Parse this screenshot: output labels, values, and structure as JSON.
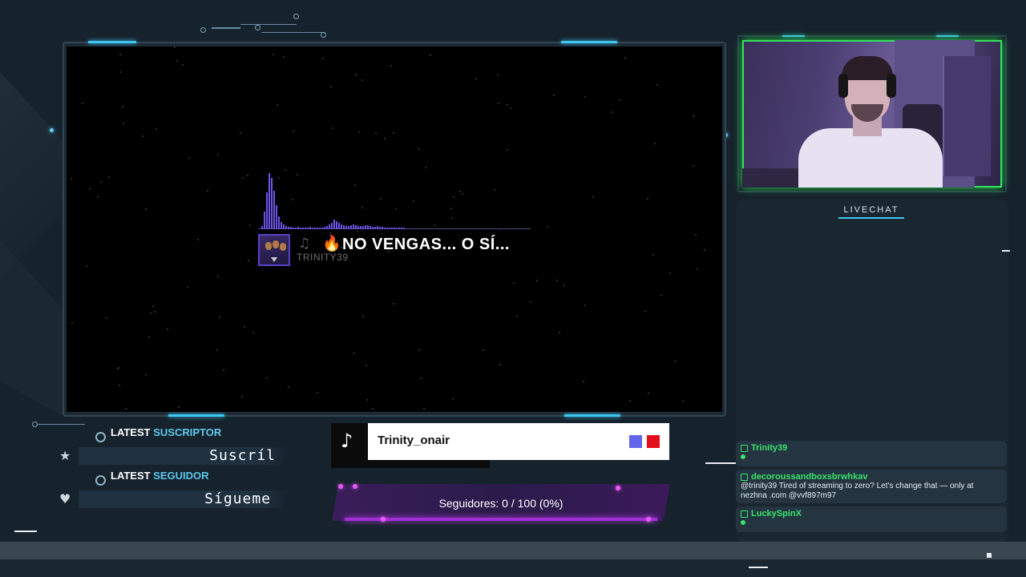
{
  "music_player": {
    "song_title": "NO VENGAS... O SÍ...",
    "artist": "TRINITY39",
    "icons": [
      "music-note-icon",
      "fire-icon"
    ]
  },
  "livechat": {
    "title": "LIVECHAT",
    "messages": [
      {
        "user": "Trinity39",
        "text": ""
      },
      {
        "user": "decoroussandboxsbrwhkav",
        "text": "@trinity39 Tired of streaming to zero? Let's change that — only at nezhna .com @vvf897m97"
      },
      {
        "user": "LuckySpinX",
        "text": ""
      }
    ],
    "accent": "#38e36b"
  },
  "latest_subscriber": {
    "label_prefix": "LATEST",
    "label_highlight": "SUSCRIPTOR",
    "value": "Suscríl"
  },
  "latest_follower": {
    "label_prefix": "LATEST",
    "label_highlight": "SEGUIDOR",
    "value": "Sígueme"
  },
  "tiktok": {
    "username": "Trinity_onair",
    "icon": "tiktok-icon"
  },
  "follower_goal": {
    "label": "Seguidores:",
    "value": "0 / 100 (0%)",
    "progress": 0
  },
  "colors": {
    "accent_cyan": "#3fc6ef",
    "visualizer": "#6b54e6",
    "webcam_border": "#31e35a",
    "goal_purple": "#a12fd6"
  }
}
